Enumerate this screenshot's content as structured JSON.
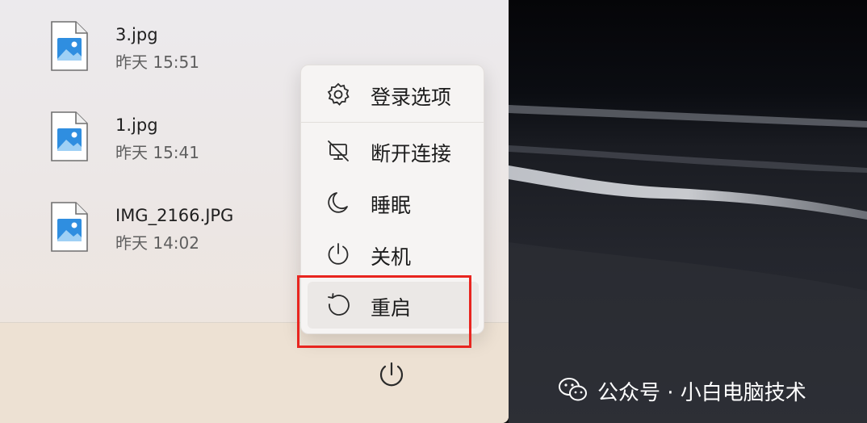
{
  "recent_files": [
    {
      "name": "3.jpg",
      "time": "昨天 15:51",
      "icon": "image-file-icon"
    },
    {
      "name": "1.jpg",
      "time": "昨天 15:41",
      "icon": "image-file-icon"
    },
    {
      "name": "IMG_2166.JPG",
      "time": "昨天 14:02",
      "icon": "image-file-icon"
    }
  ],
  "power_menu": {
    "items": [
      {
        "label": "登录选项",
        "icon": "gear-icon"
      },
      {
        "label": "断开连接",
        "icon": "disconnect-icon"
      },
      {
        "label": "睡眠",
        "icon": "moon-icon"
      },
      {
        "label": "关机",
        "icon": "power-icon"
      },
      {
        "label": "重启",
        "icon": "restart-icon",
        "highlighted": true
      }
    ]
  },
  "power_button": {
    "icon": "power-icon"
  },
  "watermark": {
    "text": "公众号 · 小白电脑技术",
    "icon": "wechat-icon"
  },
  "colors": {
    "highlight_box": "#e8251f",
    "file_icon_blue": "#2f8ee0"
  }
}
